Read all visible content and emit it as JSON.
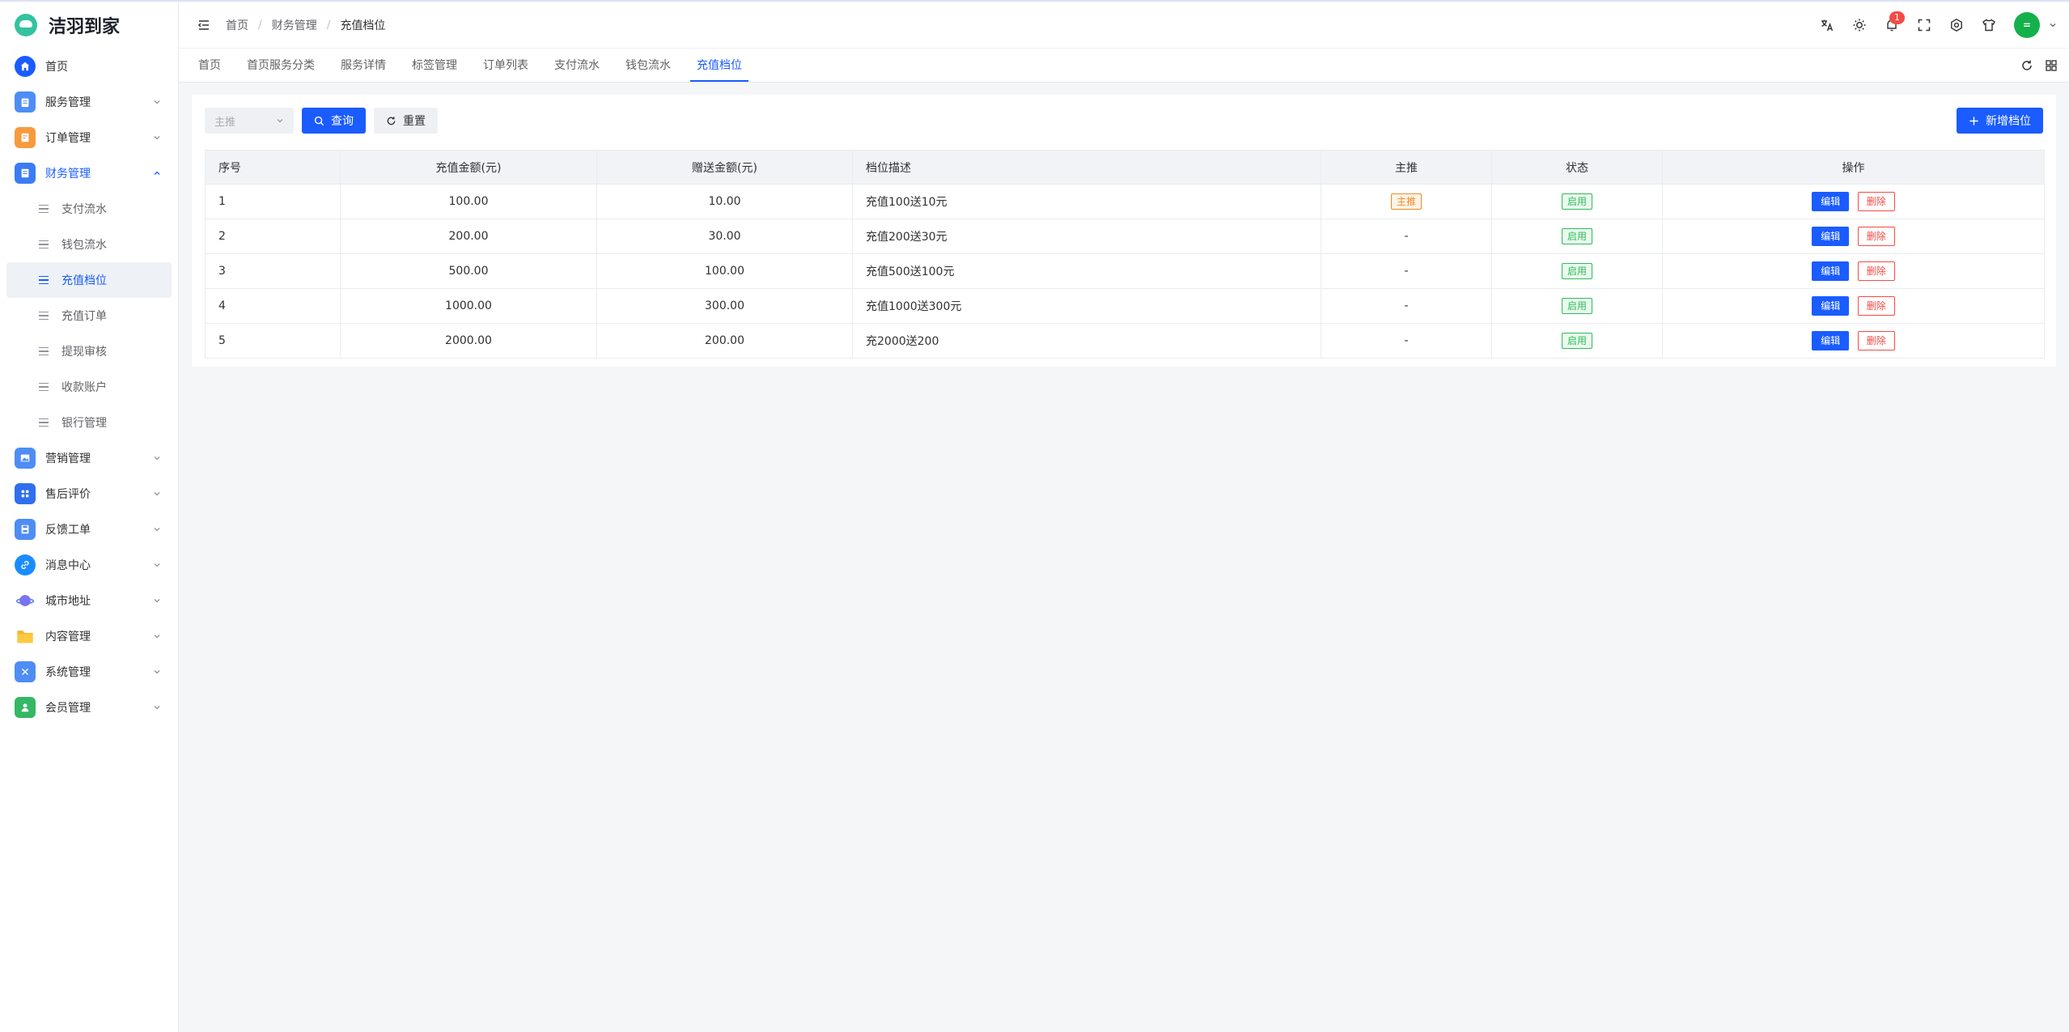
{
  "app": {
    "name": "洁羽到家"
  },
  "colors": {
    "primary": "#1a5cff",
    "success": "#2ebd59",
    "warning": "#f08a24",
    "danger": "#f54a45"
  },
  "sidebar": {
    "items": [
      {
        "label": "首页",
        "icon": "home-icon",
        "color": "#1a5cff"
      },
      {
        "label": "服务管理",
        "icon": "clipboard-icon",
        "color": "#4e8df6"
      },
      {
        "label": "订单管理",
        "icon": "order-icon",
        "color": "#f79a3e"
      },
      {
        "label": "财务管理",
        "icon": "finance-icon",
        "color": "#3b7cf4"
      },
      {
        "label": "营销管理",
        "icon": "image-icon",
        "color": "#4e8df6"
      },
      {
        "label": "售后评价",
        "icon": "grid-icon",
        "color": "#2f6ff0"
      },
      {
        "label": "反馈工单",
        "icon": "save-icon",
        "color": "#4e8df6"
      },
      {
        "label": "消息中心",
        "icon": "link-icon",
        "color": "#1a8cff"
      },
      {
        "label": "城市地址",
        "icon": "planet-icon",
        "color": "#8a6cf0"
      },
      {
        "label": "内容管理",
        "icon": "folder-icon",
        "color": "#f7b52c"
      },
      {
        "label": "系统管理",
        "icon": "tools-icon",
        "color": "#4e8df6"
      },
      {
        "label": "会员管理",
        "icon": "user-icon",
        "color": "#34b865"
      }
    ],
    "finance_children": [
      "支付流水",
      "钱包流水",
      "充值档位",
      "充值订单",
      "提现审核",
      "收款账户",
      "银行管理"
    ]
  },
  "header": {
    "breadcrumb": [
      "首页",
      "财务管理",
      "充值档位"
    ],
    "notification_count": "1",
    "avatar_text": "="
  },
  "tabs": [
    "首页",
    "首页服务分类",
    "服务详情",
    "标签管理",
    "订单列表",
    "支付流水",
    "钱包流水",
    "充值档位"
  ],
  "filter": {
    "select_placeholder": "主推",
    "query_label": "查询",
    "reset_label": "重置",
    "add_label": "新增档位"
  },
  "table": {
    "headers": [
      "序号",
      "充值金额(元)",
      "赠送金额(元)",
      "档位描述",
      "主推",
      "状态",
      "操作"
    ],
    "edit_label": "编辑",
    "delete_label": "删除",
    "rows": [
      {
        "no": "1",
        "amount": "100.00",
        "bonus": "10.00",
        "desc": "充值100送10元",
        "featured": "主推",
        "status": "启用"
      },
      {
        "no": "2",
        "amount": "200.00",
        "bonus": "30.00",
        "desc": "充值200送30元",
        "featured": "-",
        "status": "启用"
      },
      {
        "no": "3",
        "amount": "500.00",
        "bonus": "100.00",
        "desc": "充值500送100元",
        "featured": "-",
        "status": "启用"
      },
      {
        "no": "4",
        "amount": "1000.00",
        "bonus": "300.00",
        "desc": "充值1000送300元",
        "featured": "-",
        "status": "启用"
      },
      {
        "no": "5",
        "amount": "2000.00",
        "bonus": "200.00",
        "desc": "充2000送200",
        "featured": "-",
        "status": "启用"
      }
    ]
  }
}
